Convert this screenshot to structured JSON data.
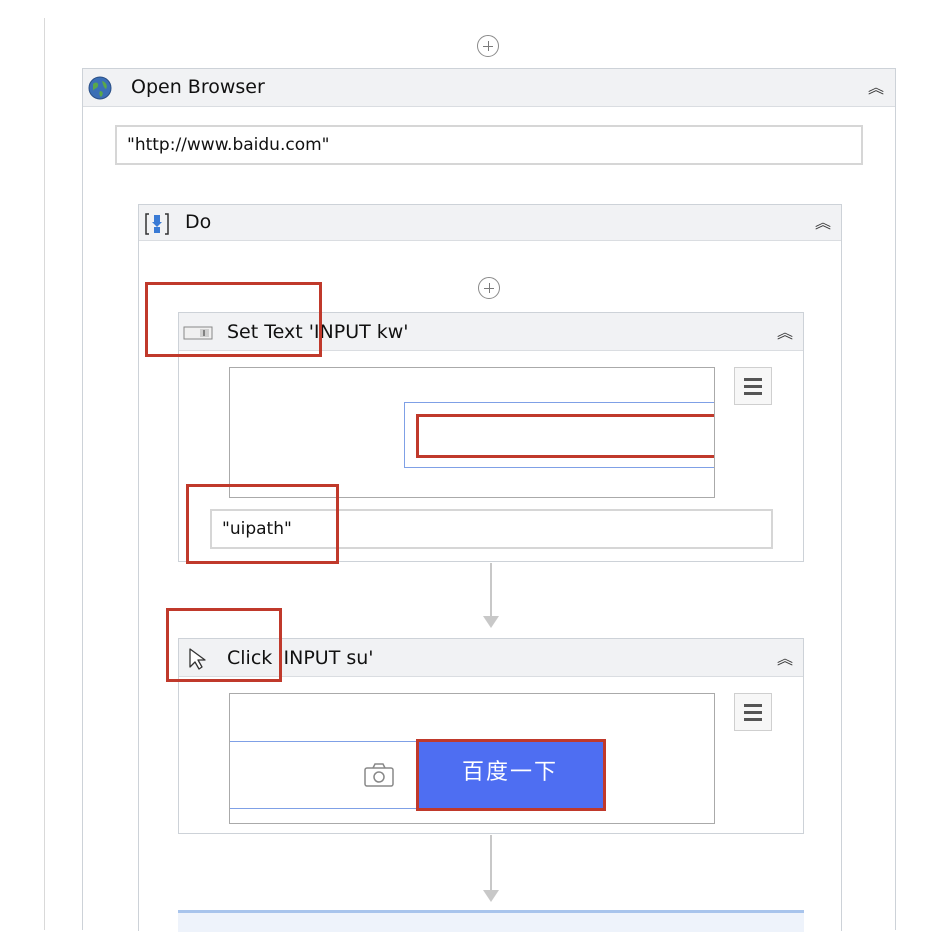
{
  "open_browser": {
    "title": "Open Browser",
    "url": "\"http://www.baidu.com\""
  },
  "do_block": {
    "title": "Do"
  },
  "set_text": {
    "title": "Set Text 'INPUT  kw'",
    "text_value": "\"uipath\""
  },
  "click": {
    "title": "Click 'INPUT  su'",
    "button_label": "百度一下"
  },
  "colors": {
    "annotation_red": "#c0392b",
    "baidu_blue": "#4e6ef2",
    "selection_blue": "#7fa0e6"
  },
  "icons": {
    "globe": "globe-icon",
    "do": "sequence-do-icon",
    "set_text": "textbox-icon",
    "click": "cursor-icon",
    "collapse": "double-chevron-up-icon",
    "menu": "hamburger-menu-icon",
    "camera": "camera-icon",
    "add": "plus-circle-icon"
  }
}
